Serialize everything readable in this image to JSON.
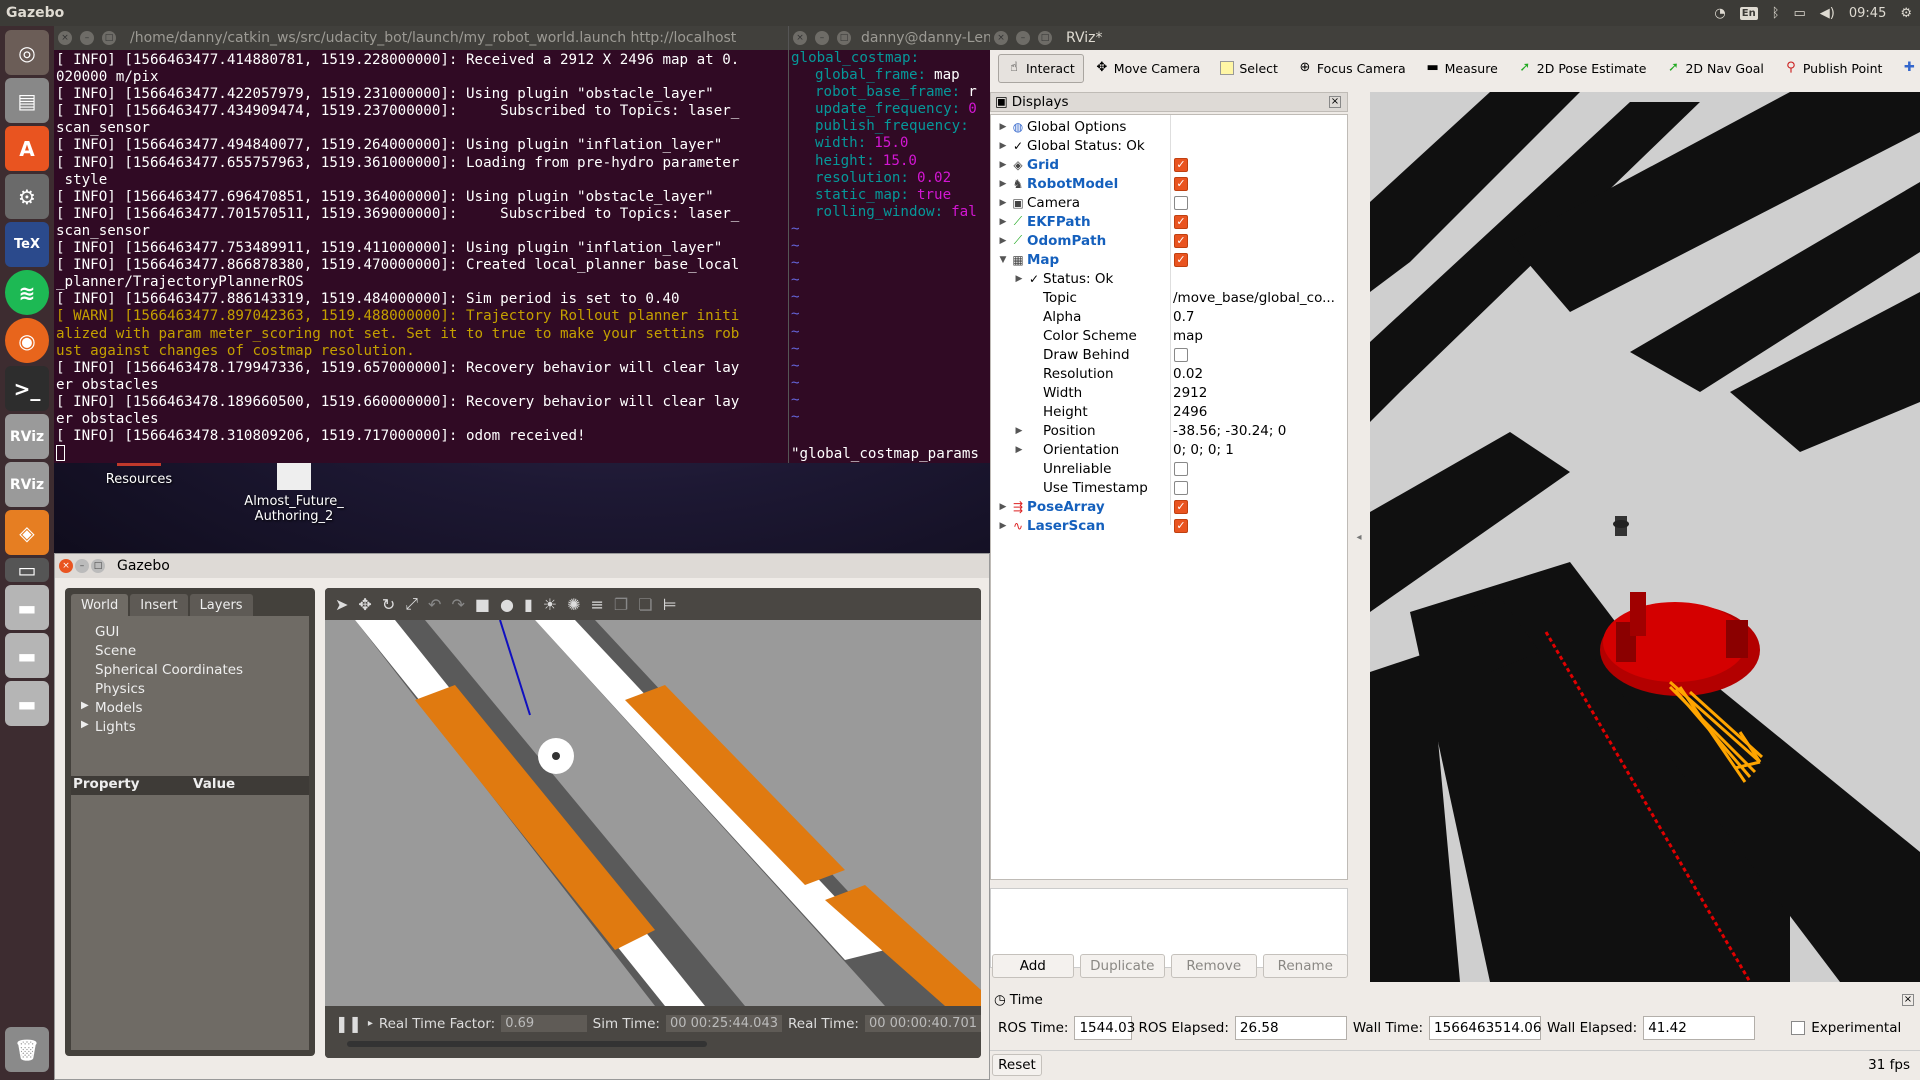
{
  "topbar": {
    "app": "Gazebo",
    "kb": "En",
    "clock": "09:45"
  },
  "desktop": {
    "icons": [
      "Resources",
      "Almost_Future_ Authoring_2"
    ]
  },
  "terminal1": {
    "title": "/home/danny/catkin_ws/src/udacity_bot/launch/my_robot_world.launch http://localhost",
    "lines": [
      {
        "t": "[ INFO] [1566463477.414880781, 1519.228000000]: Received a 2912 X 2496 map at 0.",
        "w": false
      },
      {
        "t": "020000 m/pix",
        "w": false
      },
      {
        "t": "[ INFO] [1566463477.422057979, 1519.231000000]: Using plugin \"obstacle_layer\"",
        "w": false
      },
      {
        "t": "[ INFO] [1566463477.434909474, 1519.237000000]:     Subscribed to Topics: laser_",
        "w": false
      },
      {
        "t": "scan_sensor",
        "w": false
      },
      {
        "t": "[ INFO] [1566463477.494840077, 1519.264000000]: Using plugin \"inflation_layer\"",
        "w": false
      },
      {
        "t": "[ INFO] [1566463477.655757963, 1519.361000000]: Loading from pre-hydro parameter",
        "w": false
      },
      {
        "t": " style",
        "w": false
      },
      {
        "t": "[ INFO] [1566463477.696470851, 1519.364000000]: Using plugin \"obstacle_layer\"",
        "w": false
      },
      {
        "t": "[ INFO] [1566463477.701570511, 1519.369000000]:     Subscribed to Topics: laser_",
        "w": false
      },
      {
        "t": "scan_sensor",
        "w": false
      },
      {
        "t": "[ INFO] [1566463477.753489911, 1519.411000000]: Using plugin \"inflation_layer\"",
        "w": false
      },
      {
        "t": "[ INFO] [1566463477.866878380, 1519.470000000]: Created local_planner base_local",
        "w": false
      },
      {
        "t": "_planner/TrajectoryPlannerROS",
        "w": false
      },
      {
        "t": "[ INFO] [1566463477.886143319, 1519.484000000]: Sim period is set to 0.40",
        "w": false
      },
      {
        "t": "[ WARN] [1566463477.897042363, 1519.488000000]: Trajectory Rollout planner initi",
        "w": true
      },
      {
        "t": "alized with param meter_scoring not set. Set it to true to make your settins rob",
        "w": true
      },
      {
        "t": "ust against changes of costmap resolution.",
        "w": true
      },
      {
        "t": "[ INFO] [1566463478.179947336, 1519.657000000]: Recovery behavior will clear lay",
        "w": false
      },
      {
        "t": "er obstacles",
        "w": false
      },
      {
        "t": "[ INFO] [1566463478.189660500, 1519.660000000]: Recovery behavior will clear lay",
        "w": false
      },
      {
        "t": "er obstacles",
        "w": false
      },
      {
        "t": "[ INFO] [1566463478.310809206, 1519.717000000]: odom received!",
        "w": false
      }
    ]
  },
  "terminal2": {
    "title": "danny@danny-Len",
    "root": "global_costmap:",
    "keys": [
      {
        "k": "global_frame:",
        "v": "map",
        "num": false
      },
      {
        "k": "robot_base_frame:",
        "v": "r",
        "num": false
      },
      {
        "k": "update_frequency:",
        "v": "0",
        "num": true
      },
      {
        "k": "publish_frequency:",
        "v": "",
        "num": false
      },
      {
        "k": "width:",
        "v": "15.0",
        "num": true
      },
      {
        "k": "height:",
        "v": "15.0",
        "num": true
      },
      {
        "k": "resolution:",
        "v": "0.02",
        "num": true
      },
      {
        "k": "static_map:",
        "v": "true",
        "num": true
      },
      {
        "k": "rolling_window:",
        "v": "fal",
        "num": true
      }
    ],
    "footer": "\"global_costmap_params"
  },
  "rviz": {
    "title": "RViz*",
    "tools": [
      "Interact",
      "Move Camera",
      "Select",
      "Focus Camera",
      "Measure",
      "2D Pose Estimate",
      "2D Nav Goal",
      "Publish Point"
    ],
    "displays_title": "Displays",
    "displays": [
      {
        "name": "Global Options",
        "icon": "globe-icon",
        "blue": false,
        "check": null,
        "arrow": "right",
        "indent": 0,
        "value": ""
      },
      {
        "name": "Global Status: Ok",
        "icon": "check-icon",
        "blue": false,
        "check": null,
        "arrow": "right",
        "indent": 0,
        "value": ""
      },
      {
        "name": "Grid",
        "icon": "grid-icon",
        "blue": true,
        "check": true,
        "arrow": "right",
        "indent": 0,
        "value": ""
      },
      {
        "name": "RobotModel",
        "icon": "robot-icon",
        "blue": true,
        "check": true,
        "arrow": "right",
        "indent": 0,
        "value": ""
      },
      {
        "name": "Camera",
        "icon": "camera-icon",
        "blue": false,
        "check": false,
        "arrow": "right",
        "indent": 0,
        "value": ""
      },
      {
        "name": "EKFPath",
        "icon": "path-icon",
        "blue": true,
        "check": true,
        "arrow": "right",
        "indent": 0,
        "value": ""
      },
      {
        "name": "OdomPath",
        "icon": "path-icon",
        "blue": true,
        "check": true,
        "arrow": "right",
        "indent": 0,
        "value": ""
      },
      {
        "name": "Map",
        "icon": "map-icon",
        "blue": true,
        "check": true,
        "arrow": "down",
        "indent": 0,
        "value": ""
      },
      {
        "name": "Status: Ok",
        "icon": "check-icon",
        "blue": false,
        "check": null,
        "arrow": "right",
        "indent": 1,
        "value": ""
      },
      {
        "name": "Topic",
        "icon": "",
        "blue": false,
        "check": null,
        "arrow": "",
        "indent": 1,
        "value": "/move_base/global_co..."
      },
      {
        "name": "Alpha",
        "icon": "",
        "blue": false,
        "check": null,
        "arrow": "",
        "indent": 1,
        "value": "0.7"
      },
      {
        "name": "Color Scheme",
        "icon": "",
        "blue": false,
        "check": null,
        "arrow": "",
        "indent": 1,
        "value": "map"
      },
      {
        "name": "Draw Behind",
        "icon": "",
        "blue": false,
        "check": false,
        "arrow": "",
        "indent": 1,
        "value": ""
      },
      {
        "name": "Resolution",
        "icon": "",
        "blue": false,
        "check": null,
        "arrow": "",
        "indent": 1,
        "value": "0.02"
      },
      {
        "name": "Width",
        "icon": "",
        "blue": false,
        "check": null,
        "arrow": "",
        "indent": 1,
        "value": "2912"
      },
      {
        "name": "Height",
        "icon": "",
        "blue": false,
        "check": null,
        "arrow": "",
        "indent": 1,
        "value": "2496"
      },
      {
        "name": "Position",
        "icon": "",
        "blue": false,
        "check": null,
        "arrow": "right",
        "indent": 1,
        "value": "-38.56; -30.24; 0"
      },
      {
        "name": "Orientation",
        "icon": "",
        "blue": false,
        "check": null,
        "arrow": "right",
        "indent": 1,
        "value": "0; 0; 0; 1"
      },
      {
        "name": "Unreliable",
        "icon": "",
        "blue": false,
        "check": false,
        "arrow": "",
        "indent": 1,
        "value": ""
      },
      {
        "name": "Use Timestamp",
        "icon": "",
        "blue": false,
        "check": false,
        "arrow": "",
        "indent": 1,
        "value": ""
      },
      {
        "name": "PoseArray",
        "icon": "posearray-icon",
        "blue": true,
        "check": true,
        "arrow": "right",
        "indent": 0,
        "value": ""
      },
      {
        "name": "LaserScan",
        "icon": "laser-icon",
        "blue": true,
        "check": true,
        "arrow": "right",
        "indent": 0,
        "value": ""
      }
    ],
    "buttons": {
      "add": "Add",
      "duplicate": "Duplicate",
      "remove": "Remove",
      "rename": "Rename"
    },
    "time": {
      "title": "Time",
      "ros_time_label": "ROS Time:",
      "ros_time": "1544.03",
      "ros_elapsed_label": "ROS Elapsed:",
      "ros_elapsed": "26.58",
      "wall_time_label": "Wall Time:",
      "wall_time": "1566463514.06",
      "wall_elapsed_label": "Wall Elapsed:",
      "wall_elapsed": "41.42",
      "experimental": "Experimental",
      "reset": "Reset",
      "fps": "31 fps"
    }
  },
  "gazebo": {
    "title": "Gazebo",
    "tabs": [
      "World",
      "Insert",
      "Layers"
    ],
    "tree": [
      "GUI",
      "Scene",
      "Spherical Coordinates",
      "Physics",
      "Models",
      "Lights"
    ],
    "prop_header": "Property",
    "value_header": "Value",
    "status": {
      "rtf_label": "Real Time Factor:",
      "rtf": "0.69",
      "sim_label": "Sim Time:",
      "sim": "00 00:25:44.043",
      "real_label": "Real Time:",
      "real": "00 00:00:40.701"
    }
  }
}
